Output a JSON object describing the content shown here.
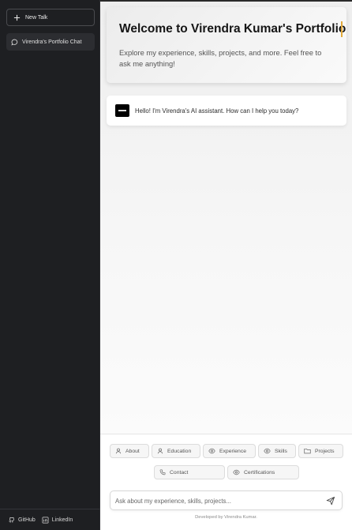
{
  "sidebar": {
    "new_talk_label": "New Talk",
    "chats": [
      {
        "label": "Virendra's Portfolio Chat"
      }
    ],
    "footer": {
      "github_label": "GitHub",
      "linkedin_label": "LinkedIn"
    }
  },
  "welcome": {
    "title": "Welcome to Virendra Kumar's Portfolio",
    "subtitle": "Explore my experience, skills, projects, and more. Feel free to ask me anything!"
  },
  "messages": [
    {
      "role": "assistant",
      "text": "Hello! I'm Virendra's AI assistant. How can I help you today?"
    }
  ],
  "quick_actions": [
    {
      "label": "About",
      "icon": "user-icon"
    },
    {
      "label": "Education",
      "icon": "user-icon"
    },
    {
      "label": "Experience",
      "icon": "eye-icon"
    },
    {
      "label": "Skills",
      "icon": "eye-icon"
    },
    {
      "label": "Projects",
      "icon": "folder-icon"
    },
    {
      "label": "Contact",
      "icon": "phone-icon"
    },
    {
      "label": "Certifications",
      "icon": "eye-icon"
    }
  ],
  "input": {
    "placeholder": "Ask about my experience, skills, projects..."
  },
  "footer": {
    "credit": "Developed by Virendra Kumar."
  },
  "colors": {
    "sidebar_bg": "#1e1f22",
    "accent_caret": "#e2a93a"
  }
}
